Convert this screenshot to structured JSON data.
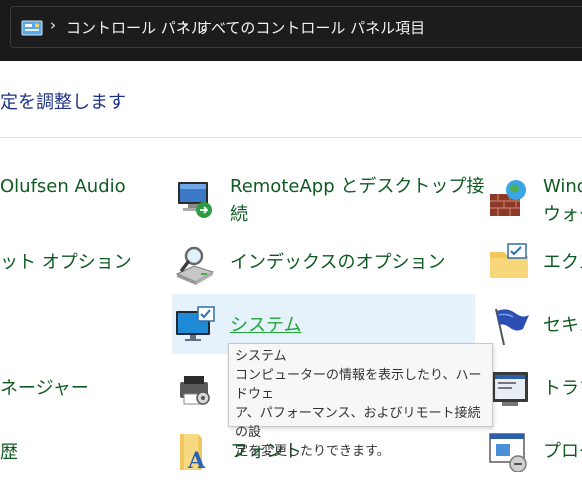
{
  "address_bar": {
    "breadcrumb": [
      "コントロール パネル",
      "すべてのコントロール パネル項目"
    ],
    "separator": "›"
  },
  "heading": "定を調整します",
  "items": {
    "col1_row1": "Olufsen Audio",
    "col1_row2": "ット オプション",
    "col1_row4": "ネージャー",
    "col1_row5": "歴",
    "remoteapp_line1": "RemoteApp とデスクトップ接",
    "remoteapp_line2": "続",
    "indexing": "インデックスのオプション",
    "system": "システム",
    "fonts": "フォント",
    "col3_row1_line1": "Wind",
    "col3_row1_line2": "ウォー",
    "col3_row2": "エクス",
    "col3_row3": "セキュ",
    "col3_row4": "トラブ",
    "col3_row5": "プログ"
  },
  "tooltip": {
    "title": "システム",
    "line1": "コンピューターの情報を表示したり、ハードウェ",
    "line2": "ア、パフォーマンス、およびリモート接続の設",
    "line3": "定を変更したりできます。"
  },
  "colors": {
    "link_green": "#0f5a22",
    "heading_blue": "#1e3287",
    "hover_bg": "#e5f1fb",
    "titlebar_bg": "#1a1a1a"
  },
  "icons": {
    "address_bar": "control-panel-icon",
    "remoteapp": "remote-desktop-icon",
    "indexing": "indexing-magnifier-icon",
    "system": "monitor-check-icon",
    "fonts": "font-folder-icon",
    "col3_row1": "firewall-globe-icon",
    "col3_row2": "folder-options-icon",
    "col3_row3": "security-flag-icon",
    "col3_row4": "troubleshoot-icon",
    "col3_row5": "default-programs-icon",
    "col2_row4": "device-printer-icon"
  }
}
